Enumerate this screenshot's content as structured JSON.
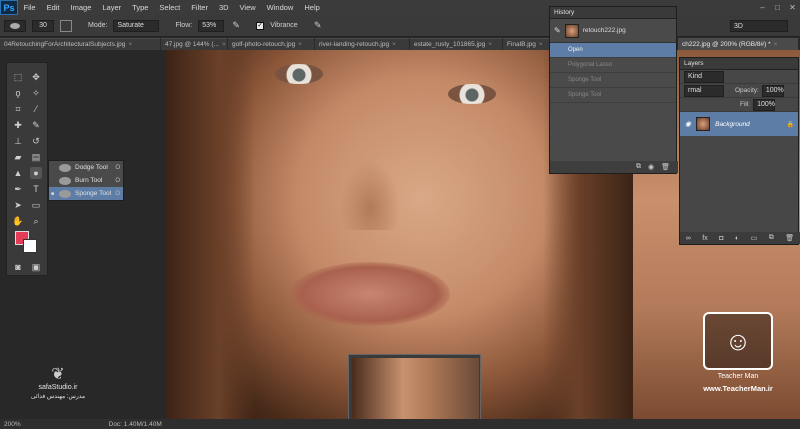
{
  "app": {
    "logo": "Ps"
  },
  "menu": [
    "File",
    "Edit",
    "Image",
    "Layer",
    "Type",
    "Select",
    "Filter",
    "3D",
    "View",
    "Window",
    "Help"
  ],
  "window_controls": {
    "minimize": "–",
    "maximize": "□",
    "close": "✕"
  },
  "options": {
    "brush_size": "30",
    "mode_label": "Mode:",
    "mode_value": "Saturate",
    "flow_label": "Flow:",
    "flow_value": "53%",
    "vibrance_check": "✓",
    "vibrance_label": "Vibrance",
    "workspace_value": "3D"
  },
  "tabs": [
    {
      "label": "04RetouchingForArchitecturalSubjects.jpg",
      "close": "×"
    },
    {
      "label": "47.jpg @ 144% (...",
      "close": "×"
    },
    {
      "label": "golf-photo-retouch.jpg",
      "close": "×"
    },
    {
      "label": "river-landing-retouch.jpg",
      "close": "×"
    },
    {
      "label": "estate_rusty_101865.jpg",
      "close": "×"
    },
    {
      "label": "FinalB.jpg",
      "close": "×"
    },
    {
      "label": "ch222.jpg @ 200% (RGB/8#) *",
      "close": "×"
    }
  ],
  "flyout": [
    {
      "label": "Dodge Tool",
      "key": "O"
    },
    {
      "label": "Burn Tool",
      "key": "O"
    },
    {
      "label": "Sponge Tool",
      "key": "O",
      "bullet": "■"
    }
  ],
  "history": {
    "title": "History",
    "snapshot_label": "retouch222.jpg",
    "items": [
      "Open",
      "Polygonal Lasso",
      "Sponge Tool",
      "Sponge Tool"
    ]
  },
  "layers": {
    "title": "Layers",
    "kind_value": "Kind",
    "blend_value": "rmal",
    "opacity_label": "Opacity:",
    "opacity_value": "100%",
    "fill_label": "Fill:",
    "fill_value": "100%",
    "layer_name": "Background",
    "lock_icon": "🔒"
  },
  "status": {
    "zoom": "200%",
    "doc": "Doc: 1.40M/1.40M"
  },
  "watermark_left": {
    "site": "safaStudio.ir",
    "credit": "مدرس: مهندس فدائی"
  },
  "watermark_right": {
    "brand": "Teacher Man",
    "site": "www.TeacherMan.ir"
  }
}
